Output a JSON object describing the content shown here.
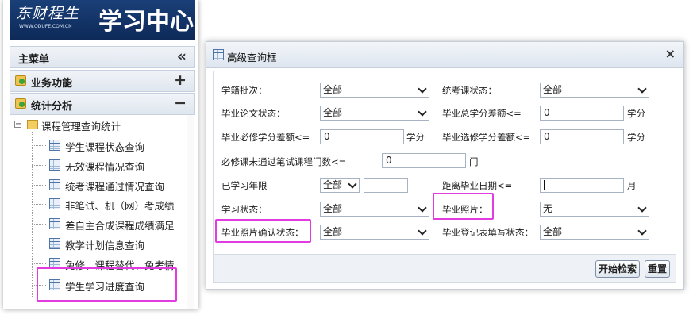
{
  "sidebar": {
    "banner_logo": "东财程生",
    "banner_url": "WWW.ODUFE.COM.CN",
    "banner_title": "学习中心",
    "main_menu": "主菜单",
    "collapse_symbol": "«",
    "sections": [
      {
        "label": "业务功能",
        "symbol": "+"
      },
      {
        "label": "统计分析",
        "symbol": "−"
      }
    ],
    "tree_root": "课程管理查询统计",
    "tree_items": [
      "学生课程状态查询",
      "无效课程情况查询",
      "统考课程通过情况查询",
      "非笔试、机（网）考成绩",
      "差自主合成课程成绩满足",
      "教学计划信息查询",
      "免修、课程替代、免考情",
      "学生学习进度查询"
    ]
  },
  "dialog": {
    "title": "高级查询框",
    "close_symbol": "×",
    "fields": {
      "enroll_batch_label": "学籍批次：",
      "enroll_batch_value": "全部",
      "exam_status_label": "统考课状态：",
      "exam_status_value": "全部",
      "thesis_status_label": "毕业论文状态：",
      "thesis_status_value": "全部",
      "total_credit_gap_label": "毕业总学分差额<=",
      "total_credit_gap_value": "0",
      "required_gap_label": "毕业必修学分差额<=",
      "required_gap_value": "0",
      "elective_gap_label": "毕业选修学分差额<=",
      "elective_gap_value": "0",
      "credit_unit": "学分",
      "unpassed_label": "必修课未通过笔试课程门数<=",
      "unpassed_value": "0",
      "unpassed_unit": "门",
      "study_years_label": "已学习年限",
      "study_years_value": "全部",
      "grad_date_label": "距离毕业日期<=",
      "grad_date_value": "",
      "month_unit": "月",
      "study_status_label": "学习状态：",
      "study_status_value": "全部",
      "photo_label": "毕业照片：",
      "photo_value": "无",
      "photo_confirm_label": "毕业照片确认状态：",
      "photo_confirm_value": "全部",
      "reg_form_label": "毕业登记表填写状态：",
      "reg_form_value": "全部"
    },
    "buttons": {
      "search": "开始检索",
      "reset": "重置"
    }
  },
  "colors": {
    "highlight": "#e23be0",
    "banner": "#0d2a58"
  }
}
